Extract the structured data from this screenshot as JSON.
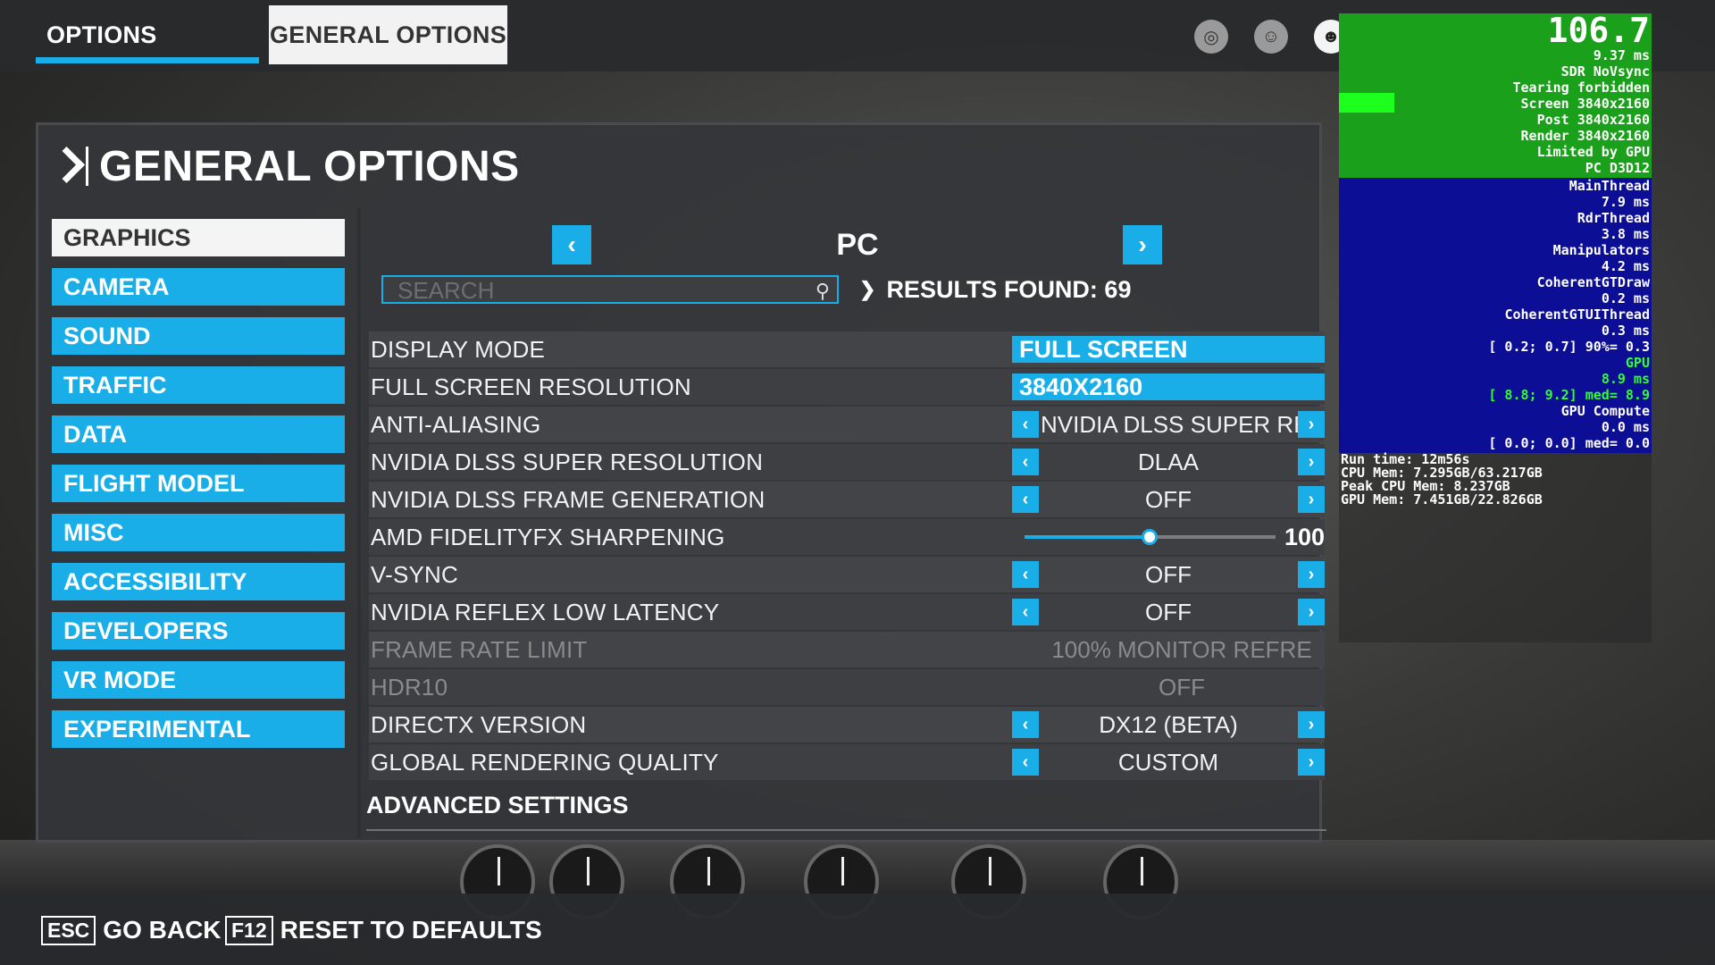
{
  "top_tabs": {
    "options": "OPTIONS",
    "general": "GENERAL OPTIONS"
  },
  "top_icons": [
    "activity-icon",
    "friends-icon",
    "profile-icon",
    "notifications-icon"
  ],
  "page_title": "GENERAL OPTIONS",
  "categories": [
    "GRAPHICS",
    "CAMERA",
    "SOUND",
    "TRAFFIC",
    "DATA",
    "FLIGHT MODEL",
    "MISC",
    "ACCESSIBILITY",
    "DEVELOPERS",
    "VR MODE",
    "EXPERIMENTAL"
  ],
  "active_category": "GRAPHICS",
  "platform": {
    "label": "PC"
  },
  "search": {
    "placeholder": "SEARCH",
    "value": ""
  },
  "results": "RESULTS FOUND: 69",
  "settings": [
    {
      "label": "DISPLAY MODE",
      "value": "FULL SCREEN",
      "kind": "selected"
    },
    {
      "label": "FULL SCREEN RESOLUTION",
      "value": "3840X2160",
      "kind": "selected"
    },
    {
      "label": "ANTI-ALIASING",
      "value": "NVIDIA DLSS SUPER RE",
      "kind": "cycle"
    },
    {
      "label": "NVIDIA DLSS SUPER RESOLUTION",
      "value": "DLAA",
      "kind": "cycle"
    },
    {
      "label": "NVIDIA DLSS FRAME GENERATION",
      "value": "OFF",
      "kind": "cycle"
    },
    {
      "label": "AMD FIDELITYFX SHARPENING",
      "value": "100",
      "kind": "slider",
      "slider_fraction": 0.5
    },
    {
      "label": "V-SYNC",
      "value": "OFF",
      "kind": "cycle"
    },
    {
      "label": "NVIDIA REFLEX LOW LATENCY",
      "value": "OFF",
      "kind": "cycle"
    },
    {
      "label": "FRAME RATE LIMIT",
      "value": "100% MONITOR REFRE",
      "kind": "disabled"
    },
    {
      "label": "HDR10",
      "value": "OFF",
      "kind": "disabled"
    },
    {
      "label": "DIRECTX VERSION",
      "value": "DX12 (BETA)",
      "kind": "cycle"
    },
    {
      "label": "GLOBAL RENDERING QUALITY",
      "value": "CUSTOM",
      "kind": "cycle"
    }
  ],
  "advanced_settings": "ADVANCED SETTINGS",
  "bottom_hints": {
    "esc_key": "ESC",
    "esc_label": "GO BACK",
    "f12_key": "F12",
    "f12_label": "RESET TO DEFAULTS"
  },
  "overlay": {
    "green_lines": [
      "106.7",
      "9.37 ms",
      "SDR NoVsync",
      "Tearing forbidden",
      "Screen 3840x2160",
      "Post 3840x2160",
      "Render 3840x2160",
      "Limited by GPU",
      "PC D3D12"
    ],
    "blue_lines": [
      "MainThread",
      "7.9 ms",
      "RdrThread",
      "3.8 ms",
      "Manipulators",
      "4.2 ms",
      "CoherentGTDraw",
      "0.2 ms",
      "CoherentGTUIThread",
      "0.3 ms",
      "[ 0.2; 0.7] 90%= 0.3",
      "GPU",
      "8.9 ms",
      "[ 8.8; 9.2] med= 8.9",
      "GPU Compute",
      "0.0 ms",
      "[ 0.0; 0.0] med= 0.0"
    ],
    "stats_lines": [
      "Run time: 12m56s",
      "CPU Mem: 7.295GB/63.217GB",
      "Peak CPU Mem: 8.237GB",
      "GPU Mem: 7.451GB/22.826GB"
    ]
  },
  "colors": {
    "accent": "#1aaee8",
    "overlay_green": "#1aa01a",
    "overlay_blue": "#0c0e96"
  }
}
